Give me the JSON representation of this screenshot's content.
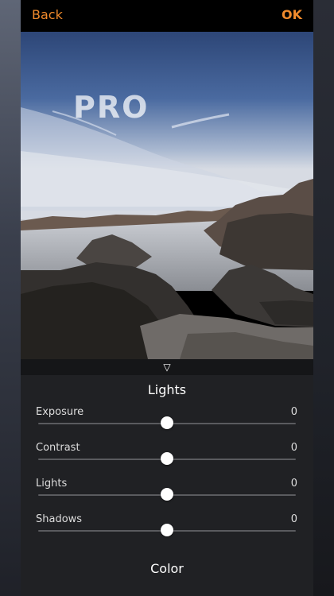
{
  "topbar": {
    "back_label": "Back",
    "ok_label": "OK",
    "accent": "#f08a2c"
  },
  "photo": {
    "watermark": "PRO"
  },
  "panel": {
    "title": "Lights",
    "collapse_icon": "triangle-down-icon",
    "sliders": [
      {
        "label": "Exposure",
        "value": "0",
        "level": 0.5
      },
      {
        "label": "Contrast",
        "value": "0",
        "level": 0.5
      },
      {
        "label": "Lights",
        "value": "0",
        "level": 0.5
      },
      {
        "label": "Shadows",
        "value": "0",
        "level": 0.5
      }
    ],
    "next_section": "Color"
  }
}
